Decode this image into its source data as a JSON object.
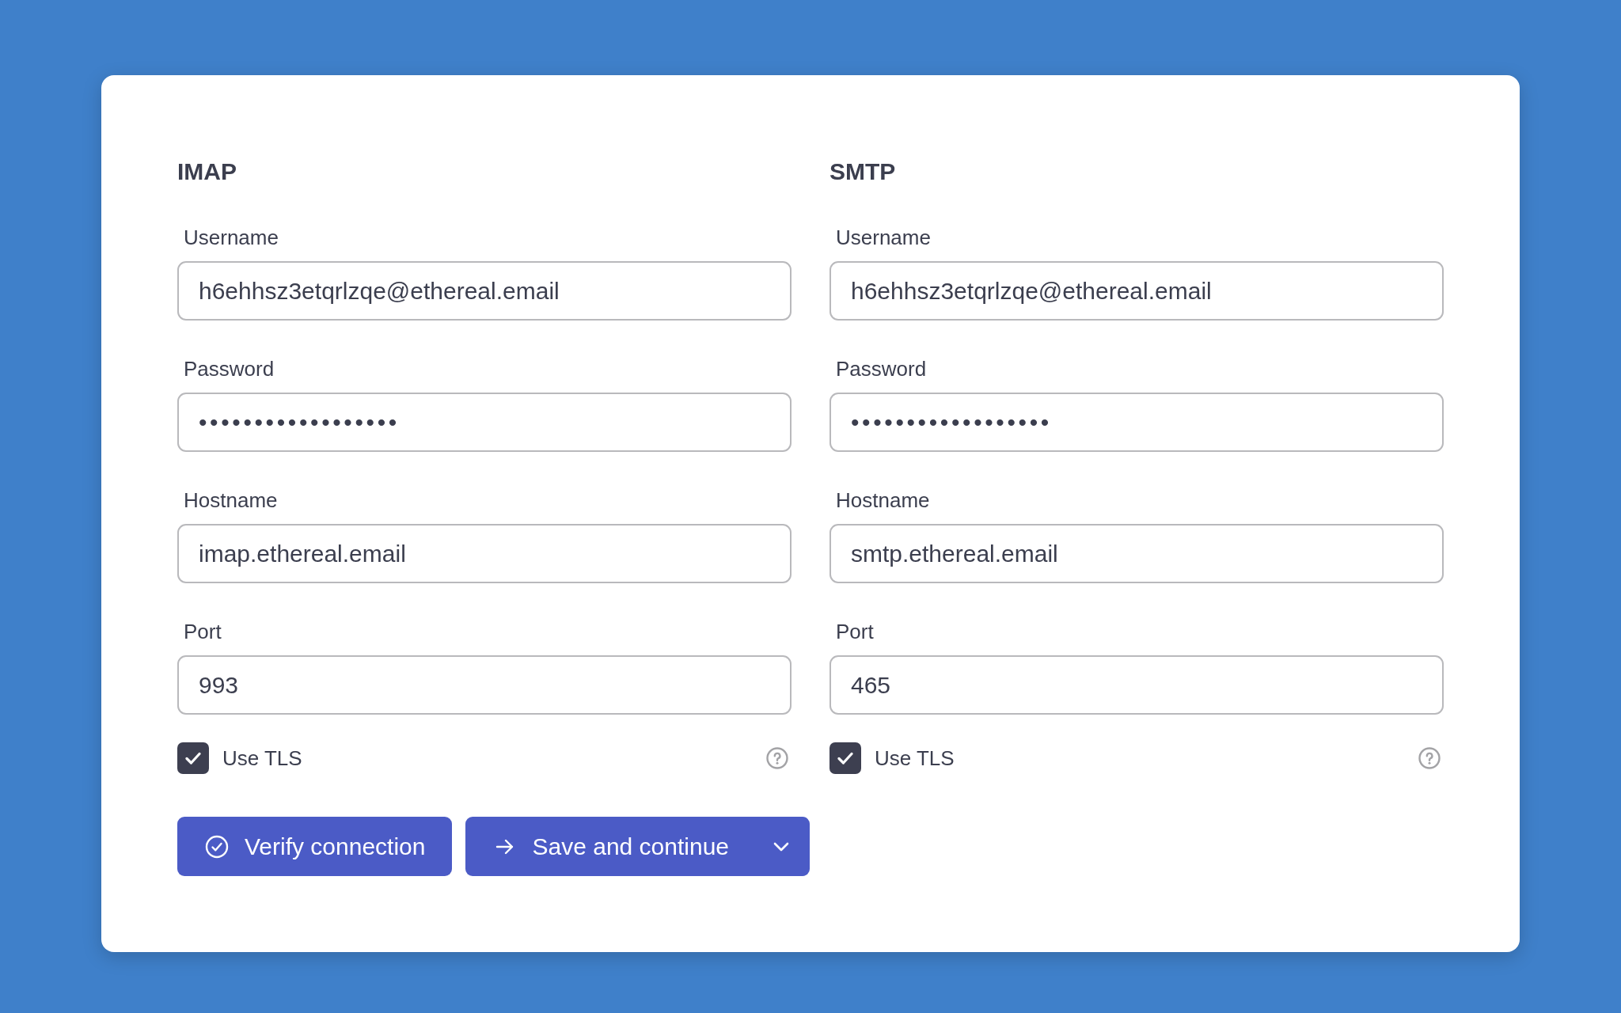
{
  "sections": [
    {
      "title": "IMAP",
      "fields": [
        {
          "label": "Username",
          "kind": "text",
          "value": "h6ehhsz3etqrlzqe@ethereal.email"
        },
        {
          "label": "Password",
          "kind": "password",
          "value": "••••••••••••••••••"
        },
        {
          "label": "Hostname",
          "kind": "text",
          "value": "imap.ethereal.email"
        },
        {
          "label": "Port",
          "kind": "text",
          "value": "993"
        }
      ],
      "use_tls": {
        "label": "Use TLS",
        "checked": true
      }
    },
    {
      "title": "SMTP",
      "fields": [
        {
          "label": "Username",
          "kind": "text",
          "value": "h6ehhsz3etqrlzqe@ethereal.email"
        },
        {
          "label": "Password",
          "kind": "password",
          "value": "••••••••••••••••••"
        },
        {
          "label": "Hostname",
          "kind": "text",
          "value": "smtp.ethereal.email"
        },
        {
          "label": "Port",
          "kind": "text",
          "value": "465"
        }
      ],
      "use_tls": {
        "label": "Use TLS",
        "checked": true
      }
    }
  ],
  "buttons": [
    {
      "kind": "verify",
      "label": "Verify connection"
    },
    {
      "kind": "split",
      "label": "Save and continue"
    }
  ]
}
